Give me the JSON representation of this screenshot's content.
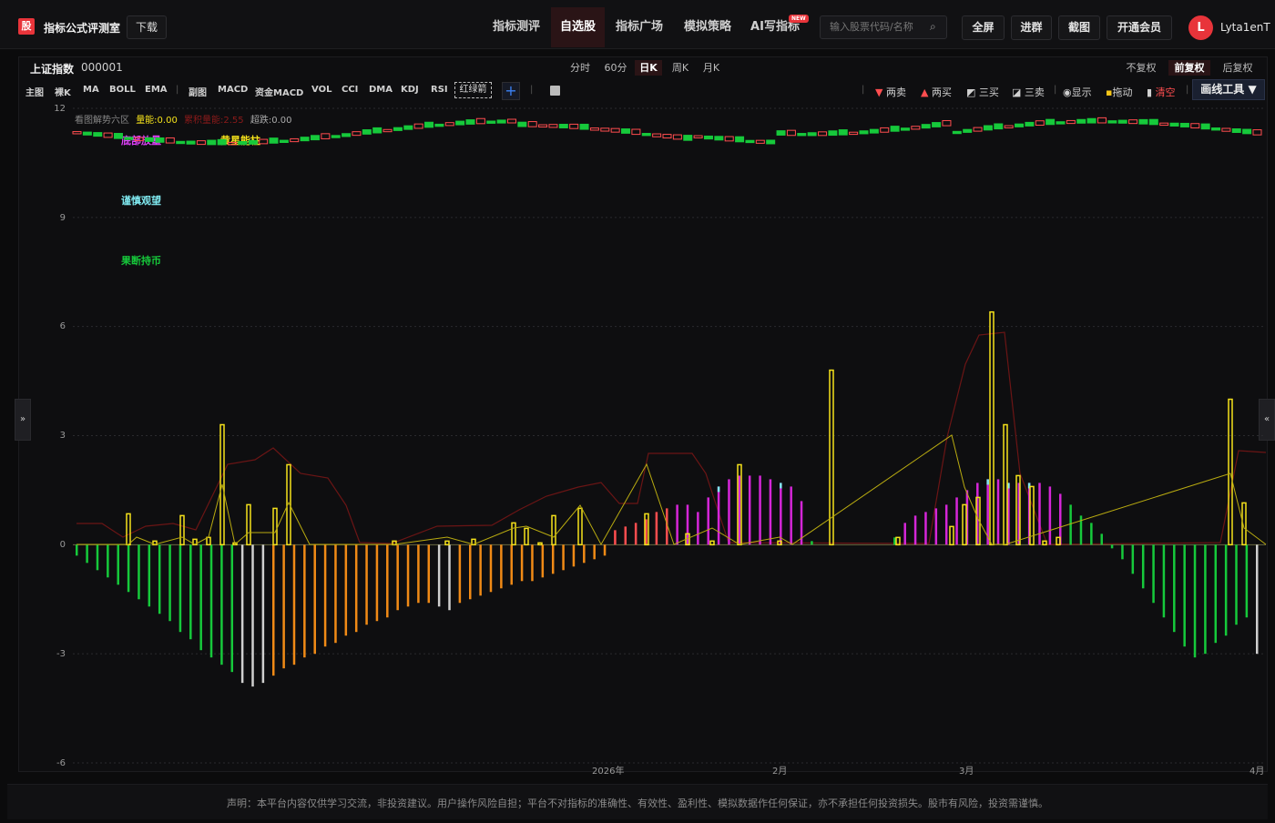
{
  "app": {
    "logo_char": "股",
    "title": "指标公式评测室",
    "download": "下载"
  },
  "nav": [
    "指标测评",
    "自选股",
    "指标广场",
    "模拟策略",
    "AI写指标"
  ],
  "new_badge": "NEW",
  "search": {
    "placeholder": "输入股票代码/名称"
  },
  "toolbar": [
    "全屏",
    "进群",
    "截图",
    "开通会员"
  ],
  "user": {
    "initial": "L",
    "name": "Lyta1enT"
  },
  "symbol": {
    "name": "上证指数",
    "code": "000001"
  },
  "periods": [
    "分时",
    "60分",
    "日K",
    "周K",
    "月K"
  ],
  "active_period": "日K",
  "adjust": [
    "不复权",
    "前复权",
    "后复权"
  ],
  "indicators": [
    "主图",
    "裸K",
    "MA",
    "BOLL",
    "EMA",
    "副图",
    "MACD",
    "资金MACD",
    "VOL",
    "CCI",
    "DMA",
    "KDJ",
    "RSI"
  ],
  "highlight_indicator": "红绿箭",
  "tools": {
    "two_sell": "两卖",
    "two_buy": "两买",
    "three_buy": "三买",
    "three_sell": "三卖",
    "show": "显示",
    "drag": "拖动",
    "clear": "清空"
  },
  "draw_tools": "画线工具 ▼",
  "legend": {
    "title": "看图解势六区",
    "a": "量能:0.00",
    "b": "累积量能:2.55",
    "c": "超跌:0.00"
  },
  "chart_labels": [
    "底部放量",
    "黄星能柱",
    "谨慎观望",
    "果断持币"
  ],
  "colors": {
    "up": "#ff4d4f",
    "down": "#16c93b",
    "yellow": "#f5e21b",
    "magenta": "#d526d8",
    "orange": "#f08a16",
    "cyan": "#7fe8ef",
    "white": "#cfcfcf",
    "accent": "#e8343a"
  },
  "chart_data": {
    "type": "bar",
    "ylim": [
      -6,
      12
    ],
    "yticks": [
      12,
      9,
      6,
      3,
      0,
      -3,
      -6
    ],
    "xlabels": [
      "2026年",
      "2月",
      "3月",
      "4月"
    ],
    "oscillator": [
      -0.3,
      -0.5,
      -0.7,
      -0.9,
      -1.1,
      -1.3,
      -1.5,
      -1.7,
      -1.9,
      -2.1,
      -2.4,
      -2.6,
      -2.9,
      -3.1,
      -3.3,
      -3.5,
      -3.8,
      -3.9,
      -3.8,
      -3.6,
      -3.4,
      -3.3,
      -3.1,
      -3.0,
      -2.8,
      -2.7,
      -2.5,
      -2.4,
      -2.2,
      -2.1,
      -2.0,
      -1.8,
      -1.7,
      -1.6,
      -1.6,
      -1.7,
      -1.8,
      -1.6,
      -1.5,
      -1.4,
      -1.3,
      -1.2,
      -1.1,
      -1.0,
      -1.0,
      -0.9,
      -0.8,
      -0.7,
      -0.6,
      -0.5,
      -0.4,
      -0.3,
      0.4,
      0.5,
      0.6,
      0.7,
      0.9,
      1.0,
      1.1,
      1.1,
      0.9,
      1.3,
      1.6,
      1.8,
      1.9,
      1.9,
      1.9,
      1.8,
      1.7,
      1.6,
      1.2,
      0.1,
      0,
      0,
      0,
      0,
      0,
      0,
      0,
      0.2,
      0.6,
      0.8,
      0.9,
      1.0,
      1.1,
      1.3,
      1.5,
      1.7,
      1.8,
      1.8,
      1.7,
      1.7,
      1.7,
      1.7,
      1.6,
      1.4,
      1.1,
      0.8,
      0.6,
      0.3,
      -0.1,
      -0.4,
      -0.8,
      -1.2,
      -1.6,
      -2.0,
      -2.4,
      -2.8,
      -3.1,
      -3.0,
      -2.7,
      -2.5,
      -2.2,
      -2.0,
      -3.0
    ],
    "yellow_bars": [
      0.85,
      0.1,
      0.8,
      0.15,
      0.2,
      3.3,
      0.05,
      1.1,
      1.0,
      2.2,
      0.1,
      0.1,
      0.15,
      0.6,
      0.45,
      0.05,
      0.8,
      1.0,
      0.85,
      0.3,
      0.1,
      2.2,
      0.1,
      4.8,
      0.2,
      0.5,
      1.1,
      1.3,
      6.4,
      3.3,
      1.9,
      1.6,
      0.1,
      0.2,
      4.0,
      1.15
    ]
  }
}
